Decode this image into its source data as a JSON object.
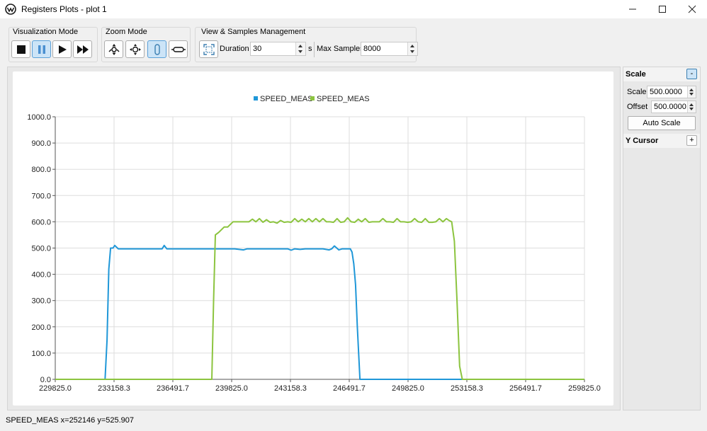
{
  "window": {
    "title": "Registers Plots - plot 1",
    "controls": [
      "minimize-icon",
      "maximize-icon",
      "close-icon"
    ]
  },
  "toolbar": {
    "visualization": {
      "label": "Visualization Mode",
      "buttons": [
        "stop-icon",
        "pause-icon",
        "play-icon",
        "fast-forward-icon"
      ],
      "active": "pause-icon"
    },
    "zoom": {
      "label": "Zoom Mode",
      "buttons": [
        "zoom-xy-icon",
        "pan-icon",
        "zoom-vertical-icon",
        "zoom-horizontal-icon"
      ],
      "active": "zoom-vertical-icon"
    },
    "view": {
      "label": "View & Samples Management",
      "fit_icon": "fit-view-icon",
      "duration_label": "Duration",
      "duration_value": "30",
      "duration_unit": "s",
      "max_samples_label": "Max Samples",
      "max_samples_value": "8000"
    }
  },
  "side_panel": {
    "scale_title": "Scale",
    "scale_collapse": "-",
    "scale_label": "Scale",
    "scale_value": "500.0000",
    "offset_label": "Offset",
    "offset_value": "500.0000",
    "auto_scale_label": "Auto Scale",
    "ycursor_title": "Y Cursor",
    "ycursor_expand": "+"
  },
  "status": {
    "text": "SPEED_MEAS x=252146 y=525.907"
  },
  "colors": {
    "series_blue": "#1f97d8",
    "series_green": "#8cc43f",
    "grid": "#dddddd",
    "active_button": "#cce4f7"
  },
  "chart_data": {
    "type": "line",
    "title": "",
    "xlabel": "",
    "ylabel": "",
    "xlim": [
      229825.0,
      259825.0
    ],
    "ylim": [
      0,
      1000
    ],
    "x_ticks": [
      "229825.0",
      "233158.3",
      "236491.7",
      "239825.0",
      "243158.3",
      "246491.7",
      "249825.0",
      "253158.3",
      "256491.7",
      "259825.0"
    ],
    "x_tick_values": [
      229825.0,
      233158.3,
      236491.7,
      239825.0,
      243158.3,
      246491.7,
      249825.0,
      253158.3,
      256491.7,
      259825.0
    ],
    "y_ticks": [
      "0.0",
      "100.0",
      "200.0",
      "300.0",
      "400.0",
      "500.0",
      "600.0",
      "700.0",
      "800.0",
      "900.0",
      "1000.0"
    ],
    "y_tick_values": [
      0,
      100,
      200,
      300,
      400,
      500,
      600,
      700,
      800,
      900,
      1000
    ],
    "grid": true,
    "legend_position": "top-center",
    "series": [
      {
        "name": "SPEED_MEAS",
        "color": "#1f97d8",
        "x": [
          229825,
          232650,
          232760,
          232860,
          232960,
          233100,
          233200,
          233400,
          233600,
          234000,
          235000,
          235880,
          236000,
          236150,
          236400,
          237000,
          238000,
          239000,
          240000,
          240500,
          240700,
          241000,
          242000,
          243000,
          243200,
          243400,
          243700,
          244000,
          244500,
          245000,
          245350,
          245500,
          245650,
          245900,
          246100,
          246300,
          246550,
          246650,
          246750,
          246850,
          246950,
          247100,
          247300,
          248000,
          250000,
          252000,
          254000,
          256000,
          258000,
          259825
        ],
        "y": [
          0,
          0,
          150,
          420,
          500,
          500,
          510,
          497,
          497,
          497,
          497,
          497,
          510,
          497,
          497,
          497,
          497,
          497,
          497,
          493,
          497,
          497,
          497,
          497,
          492,
          497,
          495,
          497,
          497,
          497,
          493,
          497,
          508,
          493,
          497,
          497,
          497,
          485,
          440,
          360,
          200,
          0,
          0,
          0,
          0,
          0,
          0,
          0,
          0,
          0
        ]
      },
      {
        "name": "SPEED_MEAS",
        "color": "#8cc43f",
        "x": [
          229825,
          238700,
          238800,
          238900,
          239100,
          239400,
          239600,
          239900,
          240200,
          240500,
          240800,
          241000,
          241200,
          241400,
          241600,
          241800,
          242000,
          242200,
          242400,
          242600,
          242800,
          243000,
          243200,
          243400,
          243600,
          243800,
          244000,
          244200,
          244400,
          244600,
          244800,
          245000,
          245200,
          245400,
          245600,
          245800,
          246000,
          246200,
          246400,
          246600,
          246800,
          247000,
          247200,
          247400,
          247600,
          247800,
          248000,
          248200,
          248400,
          248600,
          248800,
          249000,
          249200,
          249400,
          249600,
          249800,
          250000,
          250200,
          250400,
          250600,
          250800,
          251000,
          251200,
          251400,
          251600,
          251800,
          252000,
          252146,
          252300,
          252450,
          252600,
          252750,
          252900,
          253050,
          253200,
          254000,
          256000,
          258000,
          259825
        ],
        "y": [
          0,
          0,
          300,
          550,
          560,
          580,
          580,
          600,
          600,
          600,
          600,
          610,
          600,
          612,
          598,
          608,
          598,
          600,
          595,
          605,
          598,
          600,
          598,
          612,
          600,
          610,
          600,
          612,
          600,
          612,
          600,
          612,
          600,
          600,
          598,
          612,
          598,
          600,
          615,
          600,
          598,
          610,
          600,
          612,
          598,
          600,
          600,
          600,
          612,
          600,
          600,
          598,
          612,
          600,
          600,
          598,
          600,
          612,
          600,
          598,
          612,
          598,
          598,
          600,
          612,
          600,
          612,
          605,
          600,
          525.907,
          300,
          50,
          0,
          0,
          0,
          0,
          0,
          0,
          0
        ]
      }
    ]
  }
}
